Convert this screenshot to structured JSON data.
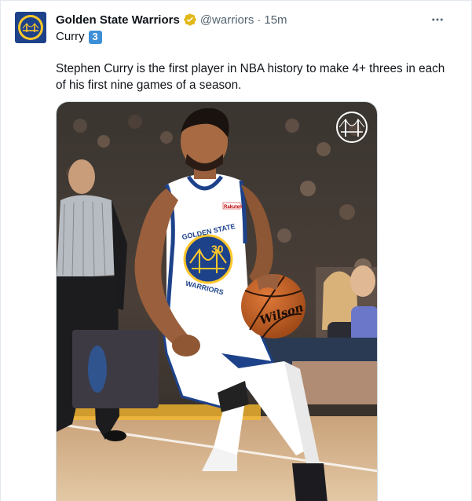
{
  "tweet": {
    "display_name": "Golden State Warriors",
    "handle": "@warriors",
    "separator": "·",
    "time": "15m",
    "line1_word": "Curry",
    "line1_badge": "3",
    "body": "Stephen Curry is the first player in NBA history to make 4+ threes in each of his first nine games of a season.",
    "media_text": {
      "jersey_top": "GOLDEN STATE",
      "jersey_bottom": "WARRIORS",
      "jersey_number": "30",
      "sponsor": "Rakuten",
      "ball_brand": "Wilson"
    }
  },
  "icons": {
    "verified": "verified-badge-icon",
    "more": "more-dots-icon",
    "avatar": "warriors-logo"
  },
  "colors": {
    "warriors_blue": "#1d428a",
    "warriors_gold": "#ffc72c",
    "verified_gold": "#e2b719",
    "secondary_text": "#536471",
    "keycap_blue": "#3c8fd6"
  }
}
